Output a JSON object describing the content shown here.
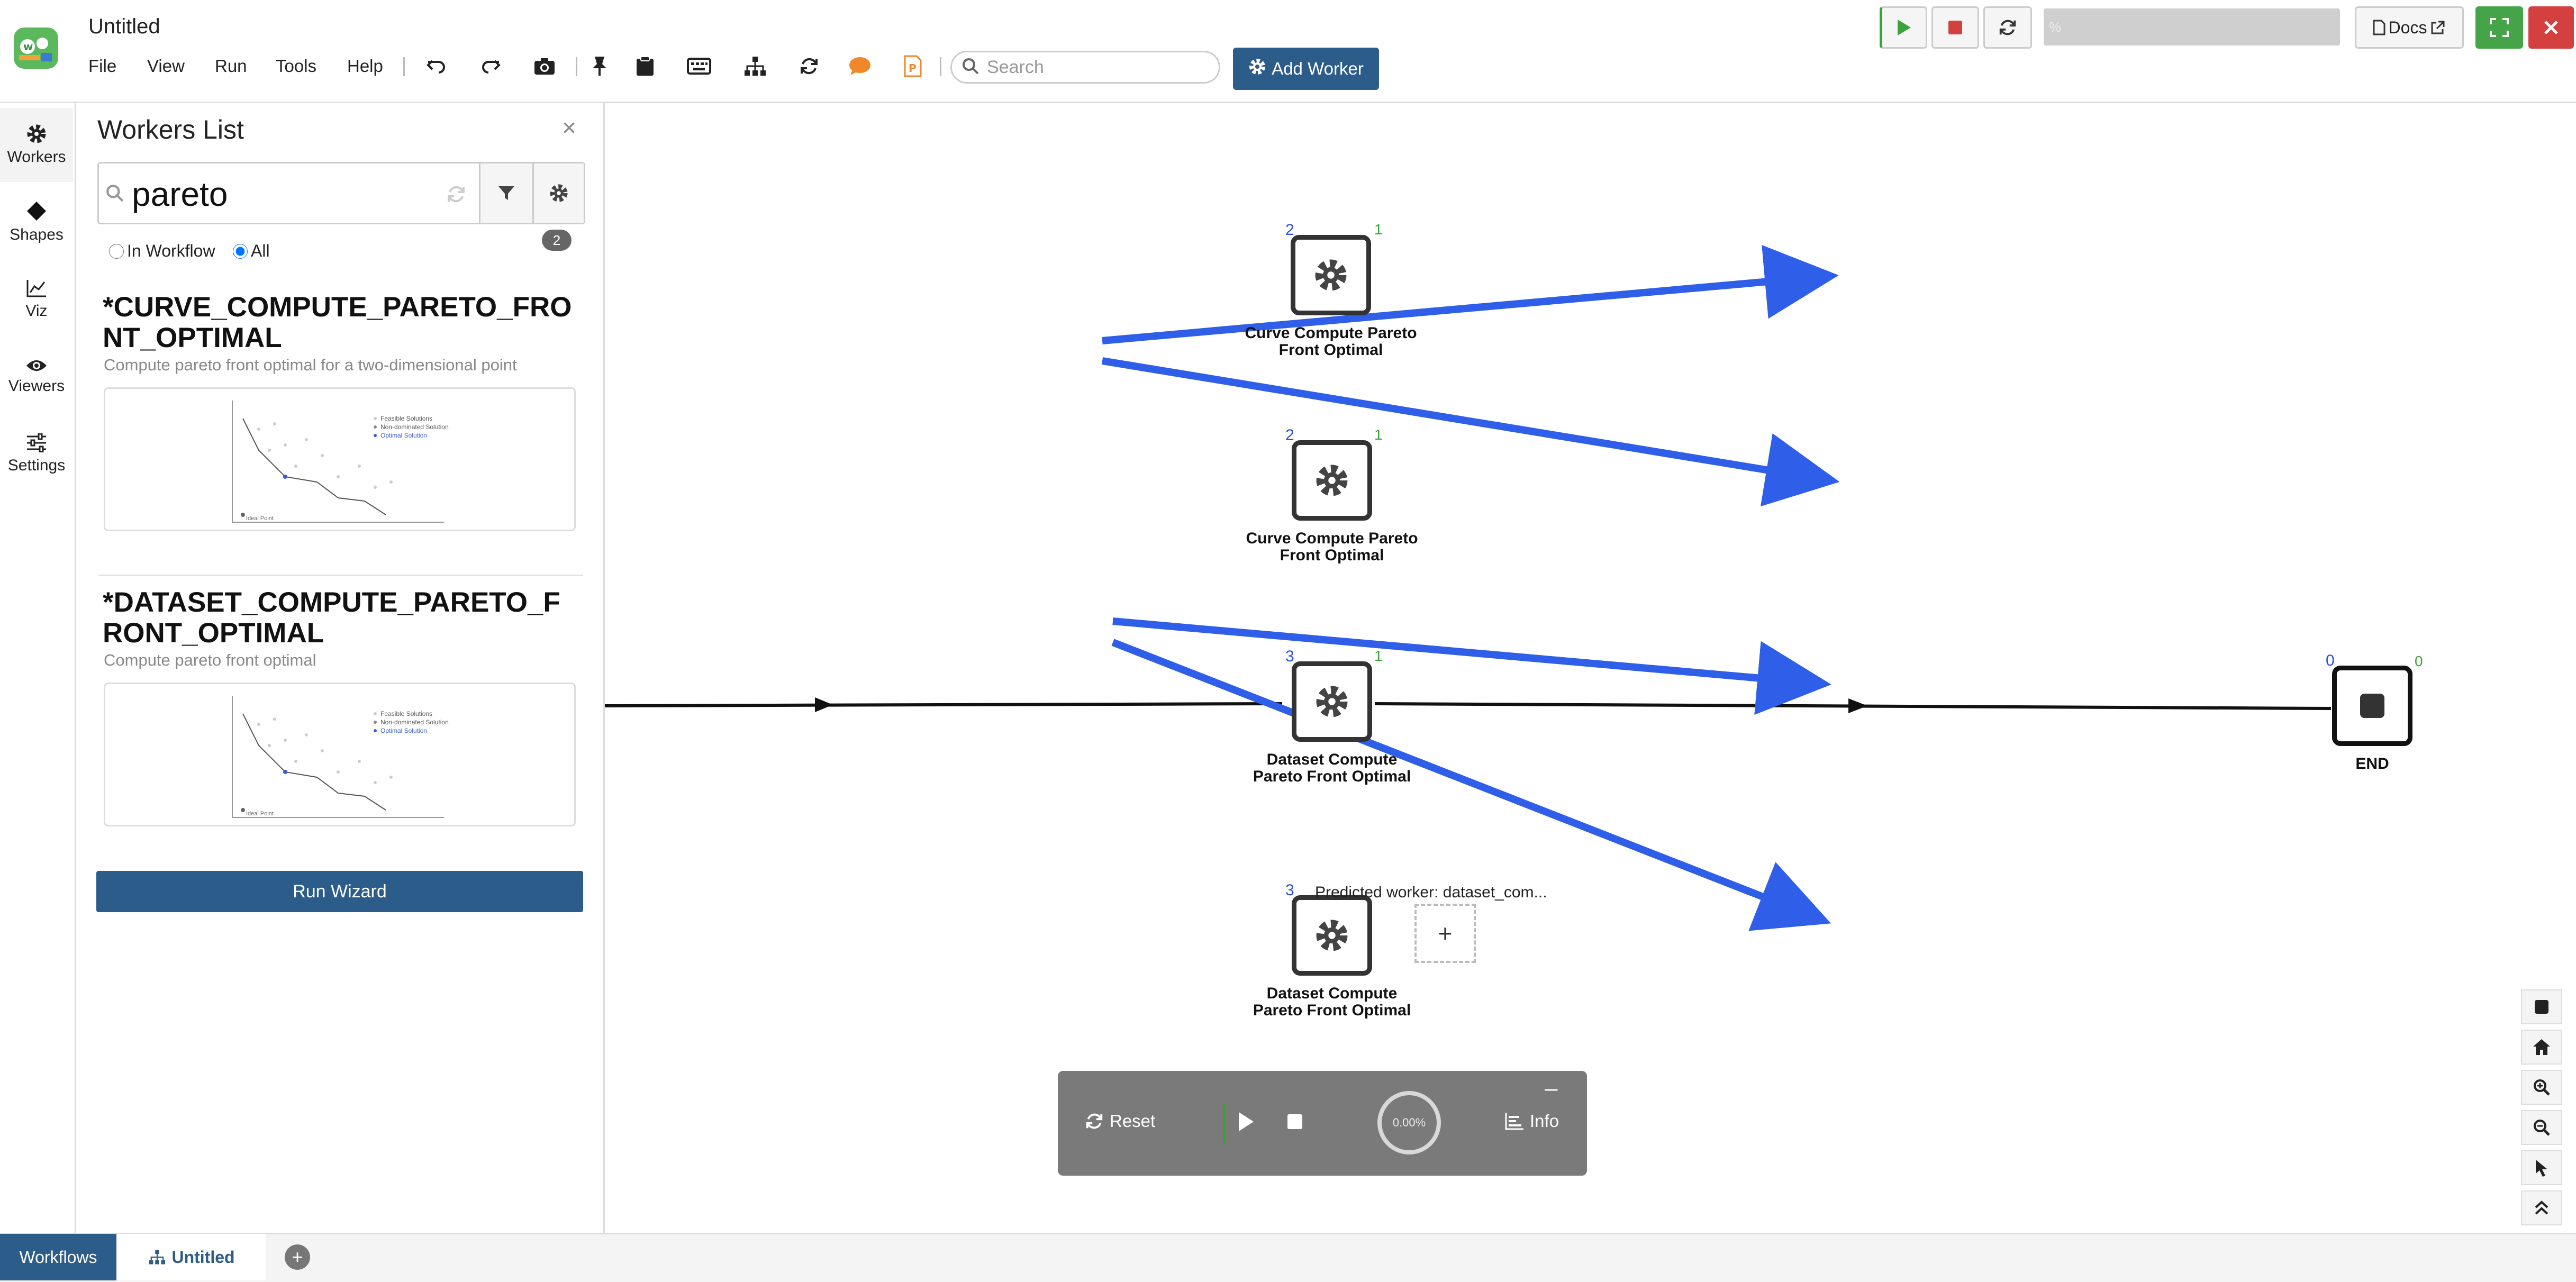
{
  "app": {
    "title": "Untitled"
  },
  "menu": [
    "File",
    "View",
    "Run",
    "Tools",
    "Help"
  ],
  "search": {
    "placeholder": "Search",
    "value": ""
  },
  "toolbar": {
    "add_worker_label": "Add Worker",
    "docs_label": "Docs",
    "progress_text": "%"
  },
  "rail": [
    {
      "label": "Workers",
      "icon": "gear-icon"
    },
    {
      "label": "Shapes",
      "icon": "diamond-icon"
    },
    {
      "label": "Viz",
      "icon": "line-chart-icon"
    },
    {
      "label": "Viewers",
      "icon": "eye-icon"
    },
    {
      "label": "Settings",
      "icon": "sliders-icon"
    }
  ],
  "panel": {
    "title": "Workers List",
    "filter_value": "pareto",
    "count": "2",
    "radio_in_workflow": "In Workflow",
    "radio_all": "All",
    "run_wizard": "Run Wizard",
    "workers": [
      {
        "title": "*CURVE_COMPUTE_PARETO_FRONT_OPTIMAL",
        "description": "Compute pareto front optimal for a two-dimensional point"
      },
      {
        "title": "*DATASET_COMPUTE_PARETO_FRONT_OPTIMAL",
        "description": "Compute pareto front optimal"
      }
    ],
    "thumb_legend": [
      "Feasible Solutions",
      "Non-dominated Solutions",
      "Optimal Solution"
    ],
    "thumb_xlabel": "Ideal Point"
  },
  "canvas": {
    "nodes": [
      {
        "label_line1": "Curve Compute Pareto",
        "label_line2": "Front Optimal",
        "ports_in": "2",
        "ports_out": "1"
      },
      {
        "label_line1": "Curve Compute Pareto",
        "label_line2": "Front Optimal",
        "ports_in": "2",
        "ports_out": "1"
      },
      {
        "label_line1": "Dataset Compute",
        "label_line2": "Pareto Front Optimal",
        "ports_in": "3",
        "ports_out": "1"
      },
      {
        "label_line1": "Dataset Compute",
        "label_line2": "Pareto Front Optimal",
        "ports_in": "3",
        "ports_out": ""
      },
      {
        "label_line1": "END",
        "label_line2": "",
        "ports_in": "0",
        "ports_out": "0"
      }
    ],
    "predicted_worker": "Predicted worker: dataset_com...",
    "add_node_symbol": "+"
  },
  "run_panel": {
    "reset": "Reset",
    "progress": "0.00%",
    "info": "Info",
    "minimize": "–"
  },
  "bottom_tabs": {
    "workflows": "Workflows",
    "untitled": "Untitled",
    "add": "+"
  },
  "colors": {
    "accent": "#2c5d8a",
    "arrow": "#2f5ee8",
    "run_green": "#3aa23a",
    "stop_red": "#d43f3f"
  }
}
